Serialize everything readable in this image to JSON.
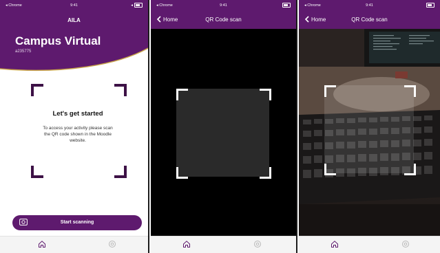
{
  "screens": [
    {
      "status": {
        "carrier": "◂ Chrome",
        "time": "9:41"
      },
      "app_header": "AILA",
      "title": "Campus Virtual",
      "user_id": "a235775",
      "card": {
        "heading": "Let's get started",
        "body": "To access your activity please scan the QR code shown in the Moodle website."
      },
      "button_label": "Start scanning"
    },
    {
      "status": {
        "carrier": "◂ Chrome",
        "time": "9:41"
      },
      "nav": {
        "back": "Home",
        "title": "QR Code scan"
      }
    },
    {
      "status": {
        "carrier": "◂ Chrome",
        "time": "9:41"
      },
      "nav": {
        "back": "Home",
        "title": "QR Code scan"
      }
    }
  ],
  "colors": {
    "brand": "#5e1a6e",
    "accent_line": "#c9a44a",
    "camera_bg": "#000000"
  },
  "icons": [
    "wifi-icon",
    "battery-icon",
    "camera-icon",
    "home-icon",
    "settings-icon",
    "chevron-left-icon"
  ]
}
